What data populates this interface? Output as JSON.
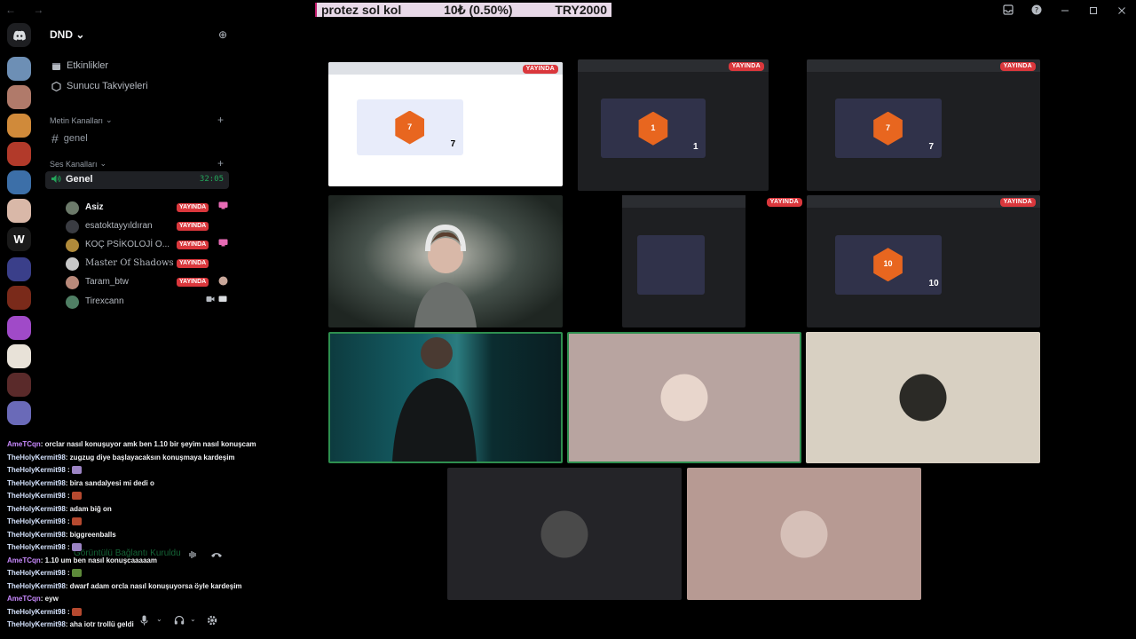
{
  "ticker": {
    "item": "protez sol kol",
    "amount": "10₺ (0.50%)",
    "goal": "TRY2000"
  },
  "titlebar": {
    "nav_arrows": "← →",
    "inbox_icon": "inbox-icon",
    "help_icon": "help-icon",
    "minimize_icon": "minimize-icon",
    "maximize_icon": "maximize-icon",
    "close_icon": "close-icon"
  },
  "server": {
    "name": "DND",
    "caret": "⌄",
    "invite_glyph": "⊕"
  },
  "nav": {
    "events": "Etkinlikler",
    "boosts": "Sunucu Takviyeleri"
  },
  "text_category": {
    "label": "Metin Kanalları",
    "caret": "⌄",
    "plus": "+"
  },
  "text_channels": [
    {
      "hash": "#",
      "name": "genel"
    }
  ],
  "voice_category": {
    "label": "Ses Kanalları",
    "caret": "⌄",
    "plus": "+"
  },
  "voice_channel": {
    "name": "Genel",
    "timer": "32:05",
    "icon": "speaker-icon"
  },
  "live_label": "YAYINDA",
  "members": [
    {
      "name": "Asiz",
      "live": true,
      "extra_icon": "screen-share-icon",
      "bold": true,
      "avatar": "#6c7a6a"
    },
    {
      "name": "esatoktayyıldıran",
      "live": true,
      "extra_icon": "",
      "bold": false,
      "avatar": "#3a3c42"
    },
    {
      "name": "KOÇ PSİKOLOJİ O...",
      "live": true,
      "extra_icon": "screen-share-icon",
      "bold": false,
      "avatar": "#b08a3a"
    },
    {
      "name": "Master Of Shadows",
      "live": true,
      "extra_icon": "",
      "bold": false,
      "avatar": "#c7c7c7"
    },
    {
      "name": "Taram_btw",
      "live": true,
      "extra_icon": "avatar-icon",
      "bold": false,
      "avatar": "#b9897a"
    },
    {
      "name": "Tirexcann",
      "live": false,
      "extra_icon": "camera-icon",
      "bold": false,
      "avatar": "#4f7f64"
    }
  ],
  "connection": {
    "status": "Görüntülü Bağlantı Kuruldu"
  },
  "chat": [
    {
      "user": "AmeTCqn",
      "color": "#c98aff",
      "text": ": orclar nasıl konuşuyor amk ben 1.10 bir şeyim nasıl konuşcam",
      "emote": ""
    },
    {
      "user": "TheHolyKermit98",
      "color": "#d6e4ff",
      "text": ": zugzug diye başlayacaksın konuşmaya kardeşim",
      "emote": ""
    },
    {
      "user": "TheHolyKermit98",
      "color": "#d6e4ff",
      "text": " : ",
      "emote": "#9c84c4"
    },
    {
      "user": "TheHolyKermit98",
      "color": "#d6e4ff",
      "text": ": bira sandalyesi mi dedi o",
      "emote": ""
    },
    {
      "user": "TheHolyKermit98",
      "color": "#d6e4ff",
      "text": " : ",
      "emote": "#b5492f"
    },
    {
      "user": "TheHolyKermit98",
      "color": "#d6e4ff",
      "text": ": adam biğ on",
      "emote": ""
    },
    {
      "user": "TheHolyKermit98",
      "color": "#d6e4ff",
      "text": " : ",
      "emote": "#b5492f"
    },
    {
      "user": "TheHolyKermit98",
      "color": "#d6e4ff",
      "text": ": biggreenballs",
      "emote": ""
    },
    {
      "user": "TheHolyKermit98",
      "color": "#d6e4ff",
      "text": " : ",
      "emote": "#9c84c4"
    },
    {
      "user": "AmeTCqn",
      "color": "#c98aff",
      "text": ": 1.10 um ben nasıl konuşcaaaaam",
      "emote": ""
    },
    {
      "user": "TheHolyKermit98",
      "color": "#d6e4ff",
      "text": " : ",
      "emote": "#5d8a3a"
    },
    {
      "user": "TheHolyKermit98",
      "color": "#d6e4ff",
      "text": ": dwarf adam orcla nasıl konuşuyorsa öyle kardeşim",
      "emote": ""
    },
    {
      "user": "AmeTCqn",
      "color": "#c98aff",
      "text": ": eyw",
      "emote": ""
    },
    {
      "user": "TheHolyKermit98",
      "color": "#d6e4ff",
      "text": " : ",
      "emote": "#b5492f"
    },
    {
      "user": "TheHolyKermit98",
      "color": "#d6e4ff",
      "text": ": aha iotr trollü geldi",
      "emote": ""
    }
  ],
  "tiles": [
    {
      "kind": "screen-light",
      "live": true,
      "d20_value": "7",
      "tally": "7"
    },
    {
      "kind": "screen-dark",
      "live": true,
      "d20_value": "1",
      "tally": "1"
    },
    {
      "kind": "screen-mixed",
      "live": true,
      "d20_value": "7",
      "tally": "7"
    },
    {
      "kind": "camera",
      "live": false
    },
    {
      "kind": "screen-dark-small",
      "live": true,
      "d20_value": "",
      "tally": ""
    },
    {
      "kind": "screen-dark",
      "live": true,
      "d20_value": "10",
      "tally": "10"
    },
    {
      "kind": "camera-dim",
      "live": false
    },
    {
      "kind": "avatar",
      "live": false,
      "bg": "#b8a4a0",
      "avatar": "#e8d6cc"
    },
    {
      "kind": "avatar",
      "live": false,
      "bg": "#d8d0c2",
      "avatar": "#2b2a26"
    },
    {
      "kind": "avatar",
      "live": false,
      "bg": "#242428",
      "avatar": "#4a4a4a"
    },
    {
      "kind": "avatar",
      "live": false,
      "bg": "#b79a93",
      "avatar": "#d6c0b8"
    }
  ],
  "colors": {
    "accent_green": "#23a55a",
    "live_red": "#da373c",
    "ticker_bg": "#e8d9e8",
    "ticker_stripe": "#c21a6b"
  }
}
